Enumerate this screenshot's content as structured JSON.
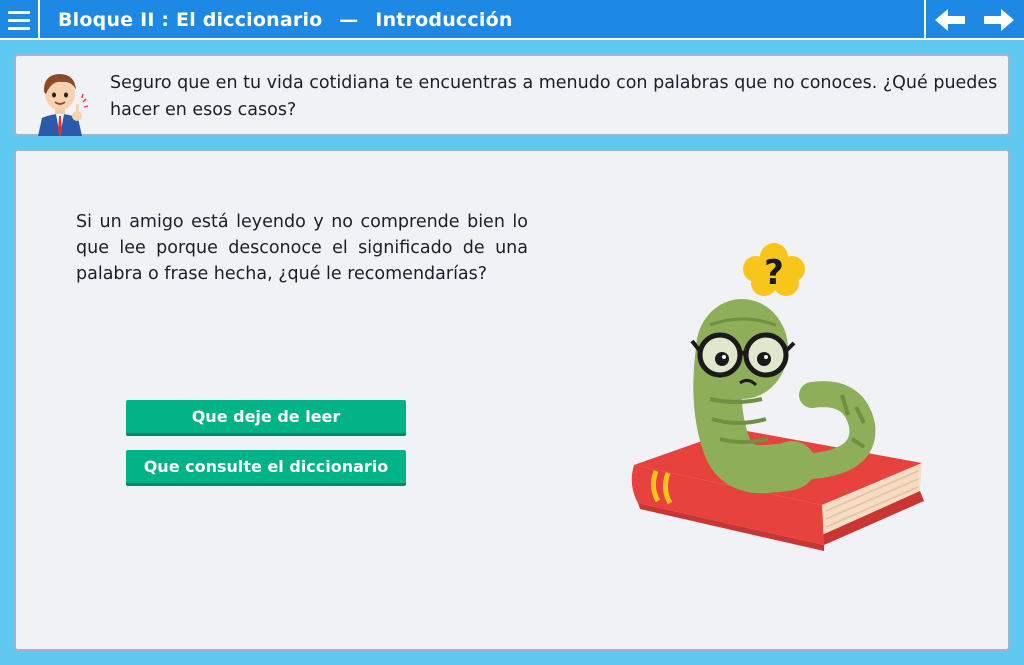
{
  "header": {
    "block": "Bloque II : El diccionario",
    "separator": "—",
    "section": "Introducción"
  },
  "intro": {
    "text": "Seguro que en tu vida cotidiana te encuentras a menudo con palabras que no conoces. ¿Qué puedes hacer en esos casos?"
  },
  "activity": {
    "question": "Si un amigo está leyendo y no comprende bien lo que lee porque desconoce el significado de una palabra o frase hecha, ¿qué le recomendarías?",
    "options": [
      {
        "label": "Que deje de leer"
      },
      {
        "label": "Que consulte el diccionario"
      }
    ]
  },
  "illustration": {
    "thought_mark": "?"
  },
  "icons": {
    "menu": "hamburger-menu-icon",
    "prev": "arrow-left-icon",
    "next": "arrow-right-icon"
  },
  "colors": {
    "background": "#5ec8f0",
    "header": "#1e88e5",
    "panel": "#f1f2f6",
    "button": "#00b386",
    "book": "#e8423f",
    "worm": "#8fae5a"
  }
}
